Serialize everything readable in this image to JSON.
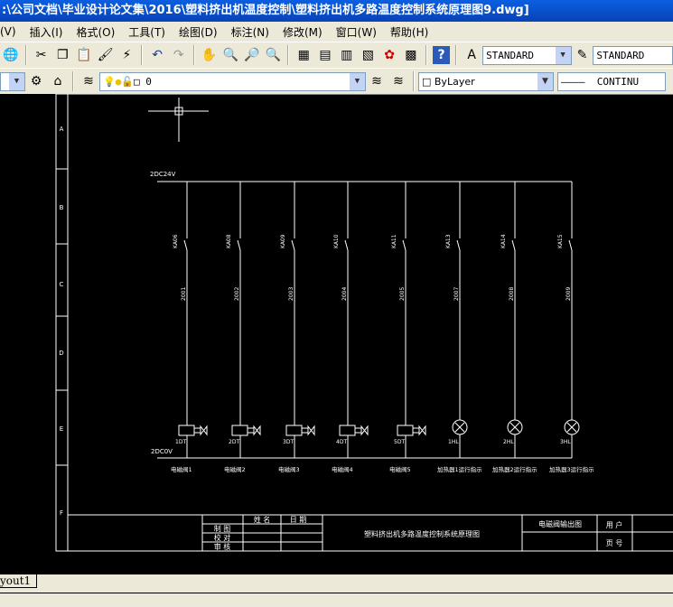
{
  "window": {
    "title": ":\\公司文档\\毕业设计论文集\\2016\\塑料挤出机温度控制\\塑料挤出机多路温度控制系统原理图9.dwg]"
  },
  "menu": [
    "(V)",
    "插入(I)",
    "格式(O)",
    "工具(T)",
    "绘图(D)",
    "标注(N)",
    "修改(M)",
    "窗口(W)",
    "帮助(H)"
  ],
  "toolbar": {
    "text_style": "STANDARD",
    "dim_style": "STANDARD",
    "layer": "0",
    "color": "ByLayer",
    "linetype": "CONTINU"
  },
  "drawing": {
    "rows": [
      "A",
      "B",
      "C",
      "D",
      "E",
      "F"
    ],
    "bus_top": "2DC24V",
    "bus_bottom": "2DC0V",
    "circuits": [
      {
        "switch": "KA06",
        "wire": "2001",
        "device": "1DT",
        "type": "valve",
        "label": "电磁阀1"
      },
      {
        "switch": "KA08",
        "wire": "2002",
        "device": "2DT",
        "type": "valve",
        "label": "电磁阀2"
      },
      {
        "switch": "KA09",
        "wire": "2003",
        "device": "3DT",
        "type": "valve",
        "label": "电磁阀3"
      },
      {
        "switch": "KA10",
        "wire": "2004",
        "device": "4DT",
        "type": "valve",
        "label": "电磁阀4"
      },
      {
        "switch": "KA11",
        "wire": "2005",
        "device": "5DT",
        "type": "valve",
        "label": "电磁阀5"
      },
      {
        "switch": "KA13",
        "wire": "2007",
        "device": "1HL",
        "type": "lamp",
        "label": "加热器1运行指示"
      },
      {
        "switch": "KA14",
        "wire": "2008",
        "device": "2HL",
        "type": "lamp",
        "label": "加热器2运行指示"
      },
      {
        "switch": "KA15",
        "wire": "2009",
        "device": "3HL",
        "type": "lamp",
        "label": "加热器3运行指示"
      }
    ],
    "title_block": {
      "name_h": "姓 名",
      "date_h": "日 期",
      "drawn": "制 图",
      "checked": "校 对",
      "approved": "审 核",
      "title": "塑料挤出机多路温度控制系统原理图",
      "sheet": "电磁阀输出图",
      "user": "用 户",
      "page": "页 号"
    }
  },
  "layout_tab": "yout1"
}
